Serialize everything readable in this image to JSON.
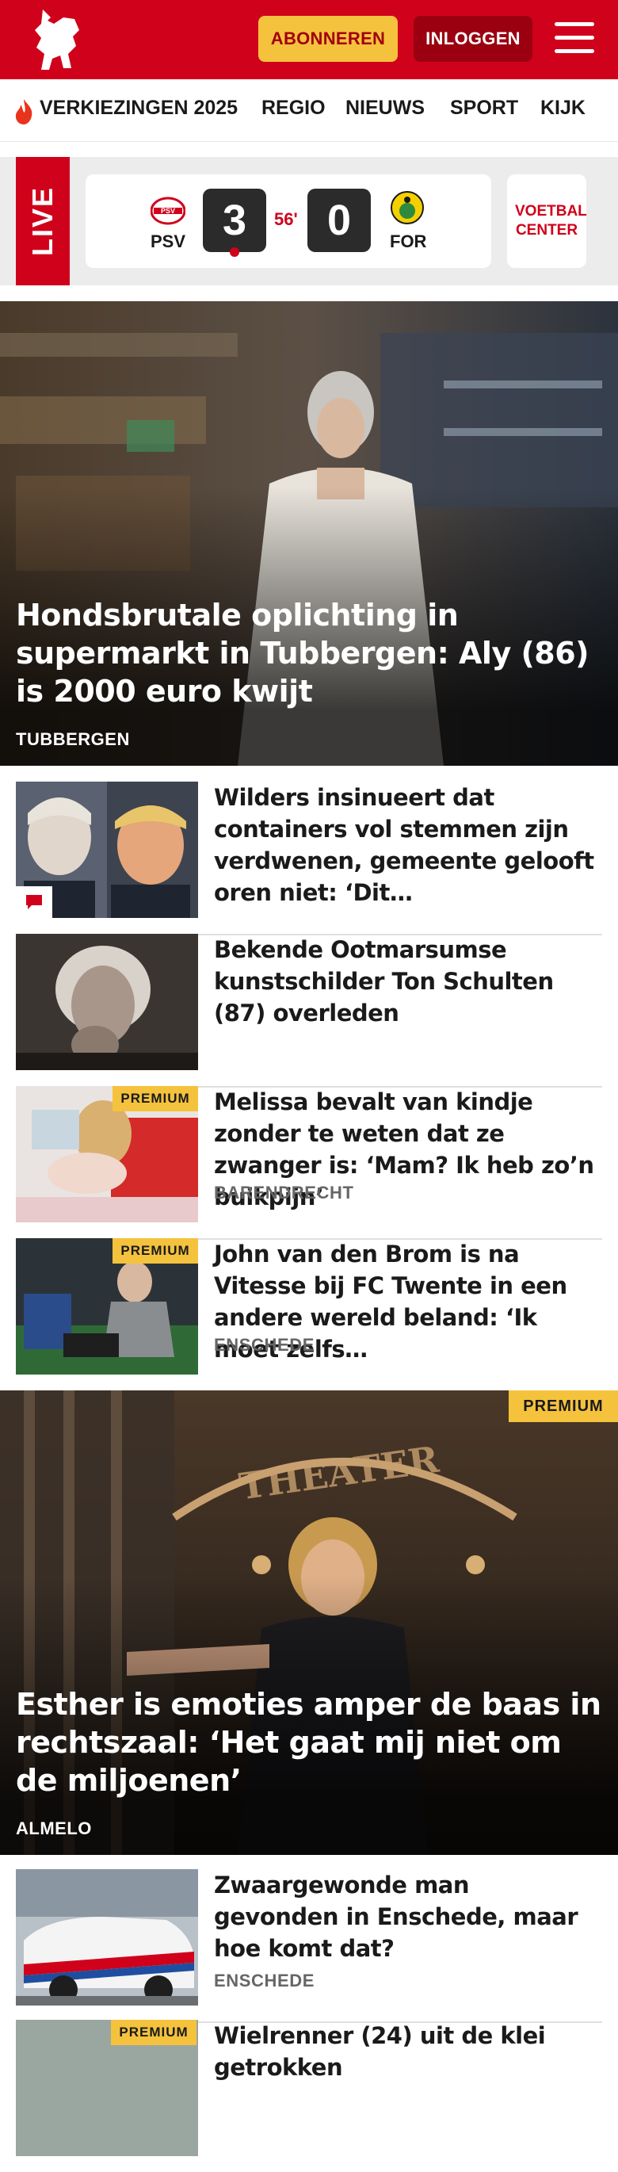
{
  "header": {
    "subscribe_label": "ABONNEREN",
    "login_label": "INLOGGEN",
    "brand_color": "#d0021b"
  },
  "nav": {
    "items": [
      "VERKIEZINGEN 2025",
      "REGIO",
      "NIEUWS",
      "SPORT",
      "KIJK"
    ]
  },
  "live": {
    "label": "LIVE",
    "home_team": "PSV",
    "away_team": "FOR",
    "home_score": "3",
    "away_score": "0",
    "minute": "56'",
    "voetbal_center": "VOETBAL CENTER"
  },
  "hero1": {
    "title": "Hondsbrutale oplichting in supermarkt in Tubbergen: Aly (86) is 2000 euro kwijt",
    "location": "TUBBERGEN"
  },
  "articles": [
    {
      "title": "Wilders insinueert dat containers vol stemmen zijn verdwenen, gemeente gelooft oren niet: ‘Dit…",
      "location": "",
      "premium": false,
      "has_comments": true
    },
    {
      "title": "Bekende Ootmarsumse kunstschilder Ton Schulten (87) overleden",
      "location": "",
      "premium": false,
      "has_comments": false
    },
    {
      "title": "Melissa bevalt van kindje zonder te weten dat ze zwanger is: ‘Mam? Ik heb zo’n buikpijn’",
      "location": "BARENDRECHT",
      "premium": true,
      "premium_label": "PREMIUM"
    },
    {
      "title": "John van den Brom is na Vitesse bij FC Twente in een andere wereld beland: ‘Ik moet zelfs…",
      "location": "ENSCHEDE",
      "premium": true,
      "premium_label": "PREMIUM"
    }
  ],
  "hero2": {
    "title": "Esther is emoties amper de baas in rechtszaal: ‘Het gaat mij niet om de miljoenen’",
    "location": "ALMELO",
    "premium_label": "PREMIUM"
  },
  "articles2": [
    {
      "title": "Zwaargewonde man gevonden in Enschede, maar hoe komt dat?",
      "location": "ENSCHEDE"
    },
    {
      "title": "Wielrenner (24) uit de klei getrokken",
      "premium_label": "PREMIUM"
    }
  ]
}
